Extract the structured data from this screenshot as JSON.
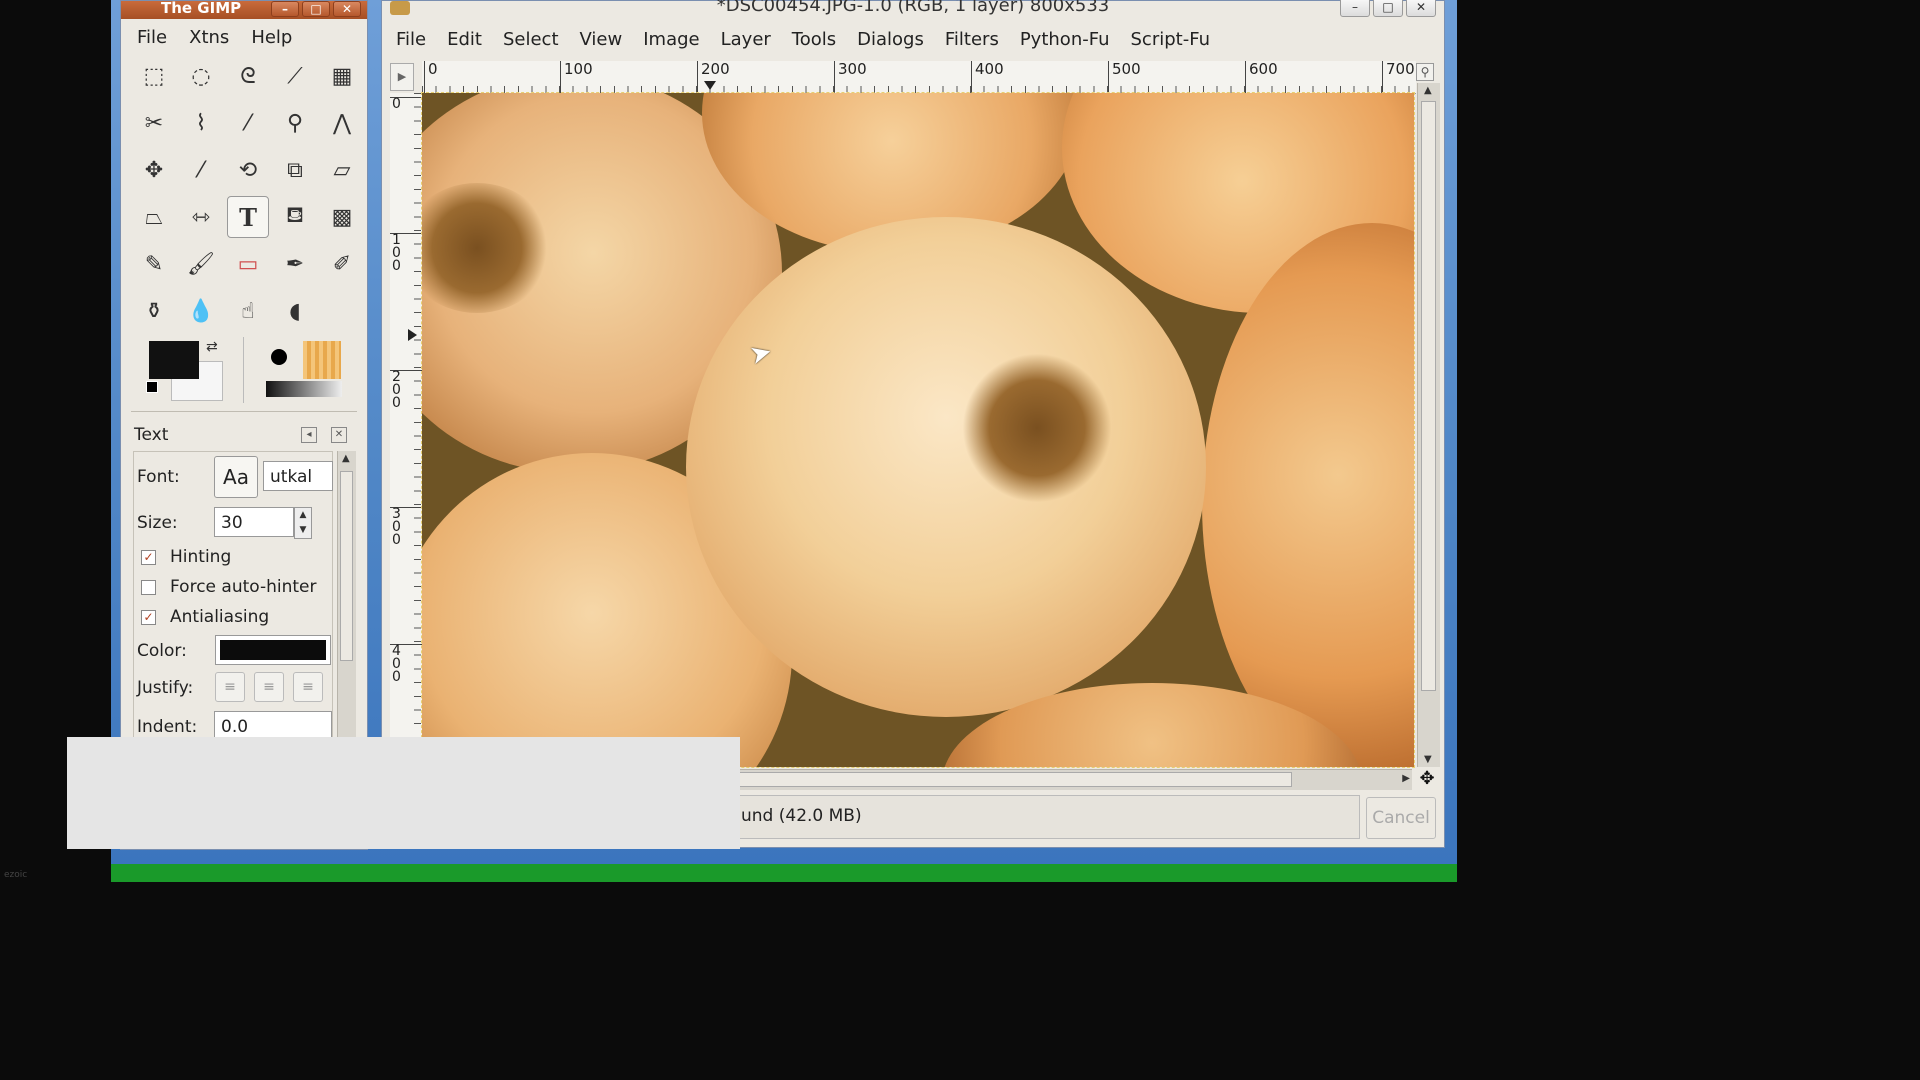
{
  "toolbox": {
    "title": "The GIMP",
    "menu": [
      "File",
      "Xtns",
      "Help"
    ],
    "tools": [
      "rect-select-icon",
      "ellipse-select-icon",
      "lasso-icon",
      "fuzzy-select-icon",
      "select-by-color-icon",
      "scissors-icon",
      "paths-icon",
      "color-picker-icon",
      "zoom-icon",
      "measure-icon",
      "move-icon",
      "crop-icon",
      "rotate-icon",
      "scale-icon",
      "shear-icon",
      "perspective-icon",
      "flip-icon",
      "text-icon",
      "bucket-fill-icon",
      "blend-icon",
      "pencil-icon",
      "paintbrush-icon",
      "eraser-icon",
      "airbrush-icon",
      "ink-icon",
      "clone-icon",
      "blur-icon",
      "smudge-icon",
      "dodge-burn-icon"
    ],
    "text_tool_glyph": "T",
    "options": {
      "header": "Text",
      "font_label": "Font:",
      "font_preview": "Aa",
      "font_value": "utkal",
      "size_label": "Size:",
      "size_value": "30",
      "hinting_label": "Hinting",
      "force_autohinter_label": "Force auto-hinter",
      "antialiasing_label": "Antialiasing",
      "color_label": "Color:",
      "text_color": "#0c0c0c",
      "justify_label": "Justify:",
      "indent_label": "Indent:",
      "indent_value": "0.0"
    }
  },
  "image_window": {
    "title": "*DSC00454.JPG-1.0 (RGB, 1 layer) 800x533",
    "menu": [
      "File",
      "Edit",
      "Select",
      "View",
      "Image",
      "Layer",
      "Tools",
      "Dialogs",
      "Filters",
      "Python-Fu",
      "Script-Fu"
    ],
    "hruler_labels": [
      "0",
      "100",
      "200",
      "300",
      "400",
      "500",
      "600",
      "700"
    ],
    "vruler_labels": [
      "0",
      "1\n0\n0",
      "2\n0\n0",
      "3\n0\n0",
      "4\n0\n0"
    ],
    "status_text": "und (42.0 MB)",
    "cancel_label": "Cancel"
  },
  "watermark": "ezoic",
  "colors": {
    "toolbox_title_bg": "#b8582c",
    "canvas_onion": "#e8b878"
  }
}
